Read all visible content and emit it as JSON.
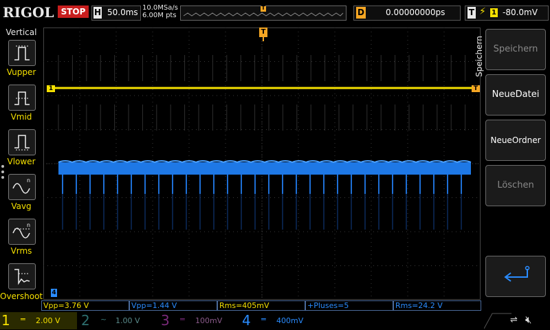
{
  "top": {
    "logo": "RIGOL",
    "run_state": "STOP",
    "horizontal_key": "H",
    "timebase": "50.0ms",
    "sample_rate": "10.0MSa/s",
    "memory_depth": "6.00M pts",
    "trigger_marker": "T",
    "delay_key": "D",
    "delay_value": "0.00000000ps",
    "trigger_key": "T",
    "trigger_edge_icon": "rising-edge-icon",
    "trigger_source": "1",
    "trigger_level": "-80.0mV"
  },
  "left_panel": {
    "title": "Vertical",
    "items": [
      {
        "label": "Vupper",
        "icon": "vupper-icon"
      },
      {
        "label": "Vmid",
        "icon": "vmid-icon"
      },
      {
        "label": "Vlower",
        "icon": "vlower-icon"
      },
      {
        "label": "Vavg",
        "icon": "vavg-icon"
      },
      {
        "label": "Vrms",
        "icon": "vrms-icon"
      },
      {
        "label": "Overshoot",
        "icon": "overshoot-icon"
      }
    ]
  },
  "grid": {
    "trigger_position_marker": "T",
    "ch1_marker": "1",
    "ch1_right_marker": "T",
    "ch4_bottom_marker": "4"
  },
  "right_panel": {
    "title": "Speichern",
    "buttons": [
      {
        "label": "Speichern",
        "enabled": false
      },
      {
        "label": "NeueDatei",
        "enabled": true
      },
      {
        "label": "NeueOrdner",
        "enabled": true
      },
      {
        "label": "Löschen",
        "enabled": false
      }
    ],
    "return_icon": "return-arrow-icon"
  },
  "measurements": [
    {
      "text": "Vpp=3.76 V",
      "color": "#f5e000"
    },
    {
      "text": "Vpp=1.44 V",
      "color": "#2a8cff"
    },
    {
      "text": "Rms=405mV",
      "color": "#f5e000"
    },
    {
      "text": "+Pluses=5",
      "color": "#2a8cff"
    },
    {
      "text": "Rms=24.2 V",
      "color": "#2a8cff"
    }
  ],
  "channels": [
    {
      "number": "1",
      "coupling": "DC",
      "scale": "2.00 V",
      "color": "#f5e000",
      "active": true
    },
    {
      "number": "2",
      "coupling": "AC",
      "scale": "1.00 V",
      "color": "#3aa0a0",
      "active": false
    },
    {
      "number": "3",
      "coupling": "DC",
      "scale": "100mV",
      "color": "#c040c0",
      "active": false
    },
    {
      "number": "4",
      "coupling": "DC",
      "scale": "400mV",
      "color": "#2a8cff",
      "active": true
    }
  ],
  "status_icons": [
    "usb-icon",
    "speaker-muted-icon"
  ],
  "colors": {
    "ch1": "#f5e000",
    "ch4": "#2a8cff",
    "trigger": "#f5a623",
    "stop": "#c81e1e"
  }
}
